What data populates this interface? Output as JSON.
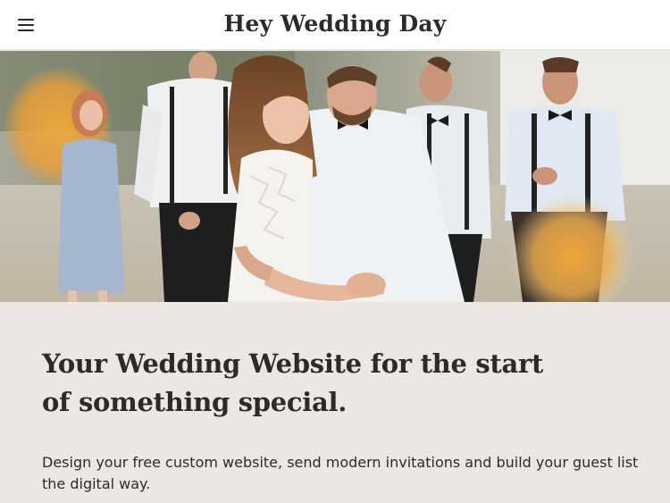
{
  "header": {
    "title": "Hey Wedding Day",
    "menu_icon": "hamburger-menu-icon"
  },
  "hero": {
    "image": "wedding-couple-photo",
    "accent_color": "#f2a93b"
  },
  "main": {
    "headline": "Your Wedding Website for the start of something special.",
    "description": "Design your free custom website, send modern invitations and build your guest list the digital way."
  },
  "colors": {
    "background": "#ede7e4",
    "text": "#2e2a2b",
    "header_bg": "#ffffff"
  }
}
